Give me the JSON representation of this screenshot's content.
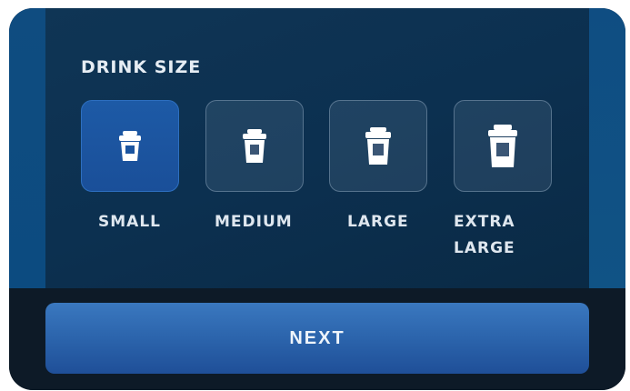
{
  "section": {
    "title": "DRINK SIZE"
  },
  "sizes": [
    {
      "label": "SMALL",
      "selected": true,
      "icon": "cup-icon-small"
    },
    {
      "label": "MEDIUM",
      "selected": false,
      "icon": "cup-icon-medium"
    },
    {
      "label": "LARGE",
      "selected": false,
      "icon": "cup-icon-large"
    },
    {
      "label": "EXTRA\nLARGE",
      "selected": false,
      "icon": "cup-icon-extra-large"
    }
  ],
  "footer": {
    "next_label": "NEXT"
  },
  "colors": {
    "panel": "#0f3555",
    "selected": "#1d5aa6",
    "accent_button": "#2a62aa",
    "bottom_bar": "#0d1a27"
  }
}
